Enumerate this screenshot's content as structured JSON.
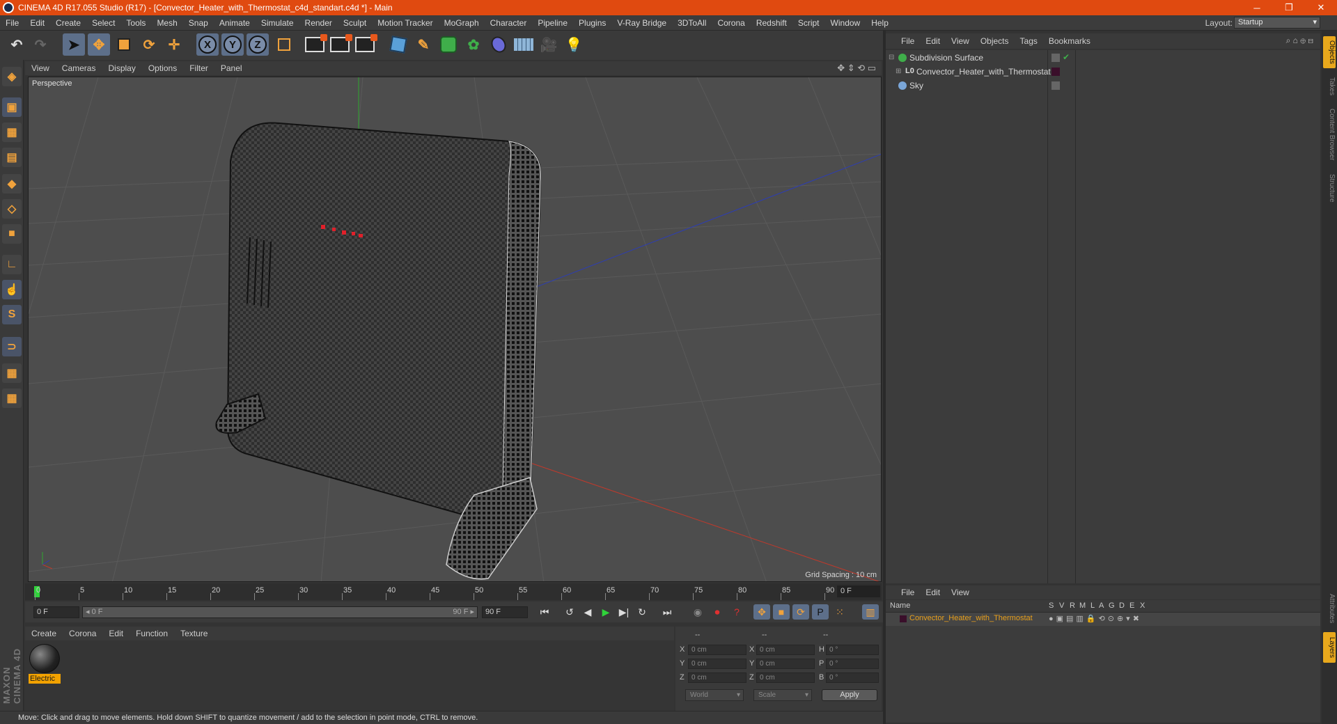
{
  "window": {
    "title": "CINEMA 4D R17.055 Studio (R17) - [Convector_Heater_with_Thermostat_c4d_standart.c4d *] - Main",
    "controls": [
      "─",
      "❐",
      "✕"
    ]
  },
  "menu": [
    "File",
    "Edit",
    "Create",
    "Select",
    "Tools",
    "Mesh",
    "Snap",
    "Animate",
    "Simulate",
    "Render",
    "Sculpt",
    "Motion Tracker",
    "MoGraph",
    "Character",
    "Pipeline",
    "Plugins",
    "V-Ray Bridge",
    "3DToAll",
    "Corona",
    "Redshift",
    "Script",
    "Window",
    "Help"
  ],
  "layout": {
    "label": "Layout:",
    "value": "Startup"
  },
  "toolbar": {
    "axis_x": "X",
    "axis_y": "Y",
    "axis_z": "Z",
    "icons": [
      "undo-icon",
      "redo-icon",
      "select-icon",
      "move-icon",
      "scale-icon",
      "rotate-icon",
      "transform-icon",
      "axis-x-icon",
      "axis-y-icon",
      "axis-z-icon",
      "coordinate-system-icon",
      "render-view-icon",
      "render-picture-viewer-icon",
      "render-settings-icon",
      "cube-icon",
      "pen-icon",
      "subdivision-icon",
      "cloner-icon",
      "deformer-icon",
      "floor-icon",
      "camera-icon",
      "light-icon"
    ]
  },
  "viewport": {
    "menu": [
      "View",
      "Cameras",
      "Display",
      "Options",
      "Filter",
      "Panel"
    ],
    "label": "Perspective",
    "grid_spacing": "Grid Spacing : 10 cm",
    "axis_colors": {
      "x": "#c0392b",
      "y": "#2ea82e",
      "z": "#2c3db5"
    }
  },
  "timeline": {
    "ticks": [
      "0",
      "5",
      "10",
      "15",
      "20",
      "25",
      "30",
      "35",
      "40",
      "45",
      "50",
      "55",
      "60",
      "65",
      "70",
      "75",
      "80",
      "85",
      "90"
    ],
    "current_frame": "0 F",
    "start": "0 F",
    "range_left": "◂ 0 F",
    "range_right": "90 F ▸",
    "end": "90 F"
  },
  "materials": {
    "menu": [
      "Create",
      "Corona",
      "Edit",
      "Function",
      "Texture"
    ],
    "items": [
      {
        "name": "Electric"
      }
    ]
  },
  "coordinates": {
    "header": [
      "--",
      "--",
      "--"
    ],
    "rows": [
      {
        "a": "X",
        "av": "0 cm",
        "b": "X",
        "bv": "0 cm",
        "c": "H",
        "cv": "0 °"
      },
      {
        "a": "Y",
        "av": "0 cm",
        "b": "Y",
        "bv": "0 cm",
        "c": "P",
        "cv": "0 °"
      },
      {
        "a": "Z",
        "av": "0 cm",
        "b": "Z",
        "bv": "0 cm",
        "c": "B",
        "cv": "0 °"
      }
    ],
    "mode": "World",
    "size_mode": "Scale",
    "apply": "Apply"
  },
  "status": "Move: Click and drag to move elements. Hold down SHIFT to quantize movement / add to the selection in point mode, CTRL to remove.",
  "objects": {
    "menu": [
      "File",
      "Edit",
      "View",
      "Objects",
      "Tags",
      "Bookmarks"
    ],
    "items": [
      {
        "name": "Subdivision Surface",
        "level": 0
      },
      {
        "name": "Convector_Heater_with_Thermostat",
        "level": 1
      },
      {
        "name": "Sky",
        "level": 0
      }
    ]
  },
  "layers": {
    "menu": [
      "File",
      "Edit",
      "View"
    ],
    "columns": [
      "Name",
      "S",
      "V",
      "R",
      "M",
      "L",
      "A",
      "G",
      "D",
      "E",
      "X"
    ],
    "items": [
      {
        "name": "Convector_Heater_with_Thermostat",
        "color": "#e8a01c"
      }
    ]
  },
  "right_tabs": [
    "Objects",
    "Takes",
    "Content Browser",
    "Structure",
    "Attributes",
    "Layers"
  ],
  "brand": "MAXON CINEMA 4D"
}
